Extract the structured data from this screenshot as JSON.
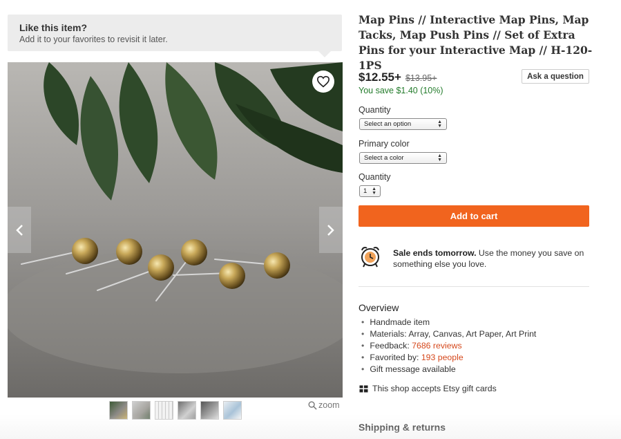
{
  "favorites_tip": {
    "title": "Like this item?",
    "subtitle": "Add it to your favorites to revisit it later."
  },
  "gallery": {
    "heart_icon": "heart-outline-icon",
    "prev_icon": "chevron-left-icon",
    "next_icon": "chevron-right-icon",
    "thumbnail_count": 6,
    "zoom_label": "zoom"
  },
  "product": {
    "title": "Map Pins // Interactive Map Pins, Map Tacks, Map Push Pins // Set of Extra Pins for your Interactive Map // H-120-1PS",
    "price": "$12.55+",
    "original_price": "$13.95+",
    "savings": "You save $1.40 (10%)",
    "ask_button": "Ask a question"
  },
  "options": {
    "quantity_label": "Quantity",
    "quantity_select": "Select an option",
    "color_label": "Primary color",
    "color_select": "Select a color",
    "qty_label": "Quantity",
    "qty_value": "1"
  },
  "cart": {
    "add_to_cart": "Add to cart"
  },
  "sale": {
    "bold": "Sale ends tomorrow.",
    "text": " Use the money you save on something else you love."
  },
  "overview": {
    "heading": "Overview",
    "handmade": "Handmade item",
    "materials": "Materials: Array, Canvas, Art Paper, Art Print",
    "feedback_prefix": "Feedback: ",
    "feedback_link": "7686 reviews",
    "favorited_prefix": "Favorited by: ",
    "favorited_link": "193 people",
    "gift_message": "Gift message available"
  },
  "giftcards": "This shop accepts Etsy gift cards",
  "shipping_heading": "Shipping & returns",
  "colors": {
    "accent": "#f1641e",
    "link": "#d5481c",
    "savings": "#247c2c"
  }
}
